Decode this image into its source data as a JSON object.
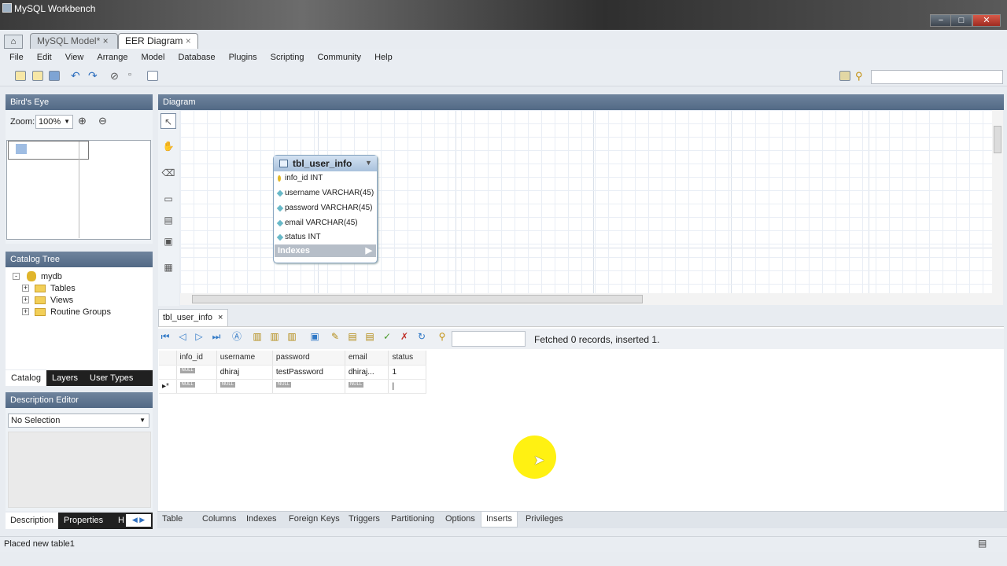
{
  "window": {
    "title": "MySQL Workbench",
    "controls": [
      "−",
      "□",
      "✕"
    ]
  },
  "tabs": [
    {
      "label": "MySQL Model*"
    },
    {
      "label": "EER Diagram"
    }
  ],
  "menu": [
    "File",
    "Edit",
    "View",
    "Arrange",
    "Model",
    "Database",
    "Plugins",
    "Scripting",
    "Community",
    "Help"
  ],
  "birds_eye": {
    "title": "Bird's Eye",
    "zoom_label": "Zoom:",
    "zoom_value": "100%"
  },
  "diagram": {
    "title": "Diagram"
  },
  "catalog": {
    "title": "Catalog Tree",
    "db": "mydb",
    "items": [
      "Tables",
      "Views",
      "Routine Groups"
    ],
    "tabs": [
      "Catalog",
      "Layers",
      "User Types"
    ]
  },
  "description": {
    "title": "Description Editor",
    "selection": "No Selection",
    "tabs": [
      "Description",
      "Properties",
      "H"
    ]
  },
  "entity": {
    "name": "tbl_user_info",
    "columns": [
      "info_id INT",
      "username VARCHAR(45)",
      "password VARCHAR(45)",
      "email VARCHAR(45)",
      "status INT"
    ],
    "indexes_label": "Indexes"
  },
  "editor": {
    "tab": "tbl_user_info",
    "status": "Fetched 0 records, inserted 1."
  },
  "result_grid": {
    "headers": [
      "info_id",
      "username",
      "password",
      "email",
      "status"
    ],
    "rows": [
      [
        "NULL",
        "dhiraj",
        "testPassword",
        "dhiraj...",
        "1"
      ],
      [
        "NULL",
        "NULL",
        "NULL",
        "NULL",
        ""
      ]
    ]
  },
  "bottom_tabs": [
    "Table",
    "Columns",
    "Indexes",
    "Foreign Keys",
    "Triggers",
    "Partitioning",
    "Options",
    "Inserts",
    "Privileges"
  ],
  "statusbar": {
    "message": "Placed new table1"
  }
}
